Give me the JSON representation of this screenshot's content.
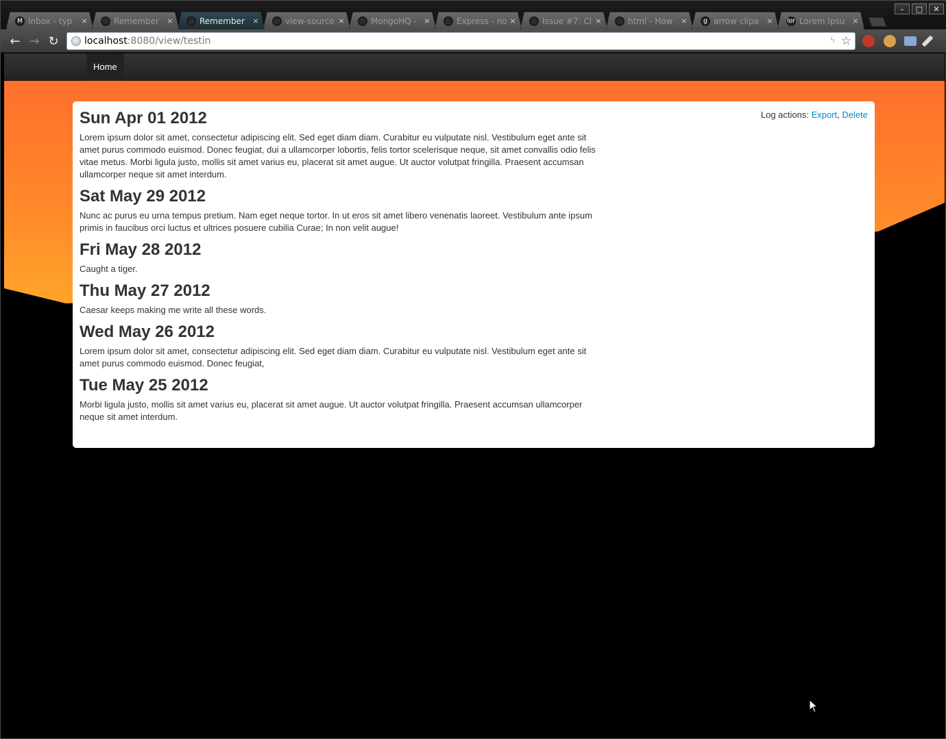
{
  "browser": {
    "tabs": [
      {
        "title": "Inbox - typ",
        "icon": "gmail-icon",
        "icon_glyph": "M",
        "active": false
      },
      {
        "title": "Remember",
        "icon": "globe-icon",
        "icon_glyph": "",
        "active": false
      },
      {
        "title": "Remember",
        "icon": "globe-icon",
        "icon_glyph": "",
        "active": true
      },
      {
        "title": "view-source",
        "icon": "globe-icon",
        "icon_glyph": "",
        "active": false
      },
      {
        "title": "MongoHQ -",
        "icon": "rocket-icon",
        "icon_glyph": "",
        "active": false
      },
      {
        "title": "Express - no",
        "icon": "globe-icon",
        "icon_glyph": "",
        "active": false
      },
      {
        "title": "Issue #7: Cl",
        "icon": "github-icon",
        "icon_glyph": "",
        "active": false
      },
      {
        "title": "html - How",
        "icon": "stackoverflow-icon",
        "icon_glyph": "",
        "active": false
      },
      {
        "title": "arrow clipa",
        "icon": "google-icon",
        "icon_glyph": "g",
        "active": false
      },
      {
        "title": "Lorem Ipsu",
        "icon": "lorem-icon",
        "icon_glyph": "lor",
        "active": false
      }
    ],
    "tab_close_glyph": "×",
    "window_controls": {
      "minimize": "–",
      "maximize": "□",
      "close": "✕"
    },
    "nav": {
      "back": "←",
      "forward": "→",
      "reload": "↻"
    },
    "url_host": "localhost",
    "url_path": ":8080/view/testin",
    "bolt_glyph": "ϟ",
    "star_glyph": "☆",
    "extensions": [
      {
        "name": "rainbow-extension-icon",
        "color": "#c03a2b"
      },
      {
        "name": "cookie-extension-icon",
        "color": "#d9a050"
      },
      {
        "name": "window-extension-icon",
        "color": "#8aa8d8"
      },
      {
        "name": "wrench-icon",
        "color": "#dddddd"
      }
    ]
  },
  "site": {
    "nav_home": "Home",
    "colors": {
      "accent_orange": "#ff7a2e",
      "link": "#0088cc"
    }
  },
  "log": {
    "actions_label": "Log actions:",
    "export_label": "Export",
    "separator": ",",
    "delete_label": "Delete",
    "entries": [
      {
        "date": "Sun Apr 01 2012",
        "text": "Lorem ipsum dolor sit amet, consectetur adipiscing elit. Sed eget diam diam. Curabitur eu vulputate nisl. Vestibulum eget ante sit amet purus commodo euismod. Donec feugiat, dui a ullamcorper lobortis, felis tortor scelerisque neque, sit amet convallis odio felis vitae metus. Morbi ligula justo, mollis sit amet varius eu, placerat sit amet augue. Ut auctor volutpat fringilla. Praesent accumsan ullamcorper neque sit amet interdum."
      },
      {
        "date": "Sat May 29 2012",
        "text": "Nunc ac purus eu urna tempus pretium. Nam eget neque tortor. In ut eros sit amet libero venenatis laoreet. Vestibulum ante ipsum primis in faucibus orci luctus et ultrices posuere cubilia Curae; In non velit augue!"
      },
      {
        "date": "Fri May 28 2012",
        "text": "Caught a tiger."
      },
      {
        "date": "Thu May 27 2012",
        "text": "Caesar keeps making me write all these words."
      },
      {
        "date": "Wed May 26 2012",
        "text": "Lorem ipsum dolor sit amet, consectetur adipiscing elit. Sed eget diam diam. Curabitur eu vulputate nisl. Vestibulum eget ante sit amet purus commodo euismod. Donec feugiat,"
      },
      {
        "date": "Tue May 25 2012",
        "text": "Morbi ligula justo, mollis sit amet varius eu, placerat sit amet augue. Ut auctor volutpat fringilla. Praesent accumsan ullamcorper neque sit amet interdum."
      }
    ]
  }
}
